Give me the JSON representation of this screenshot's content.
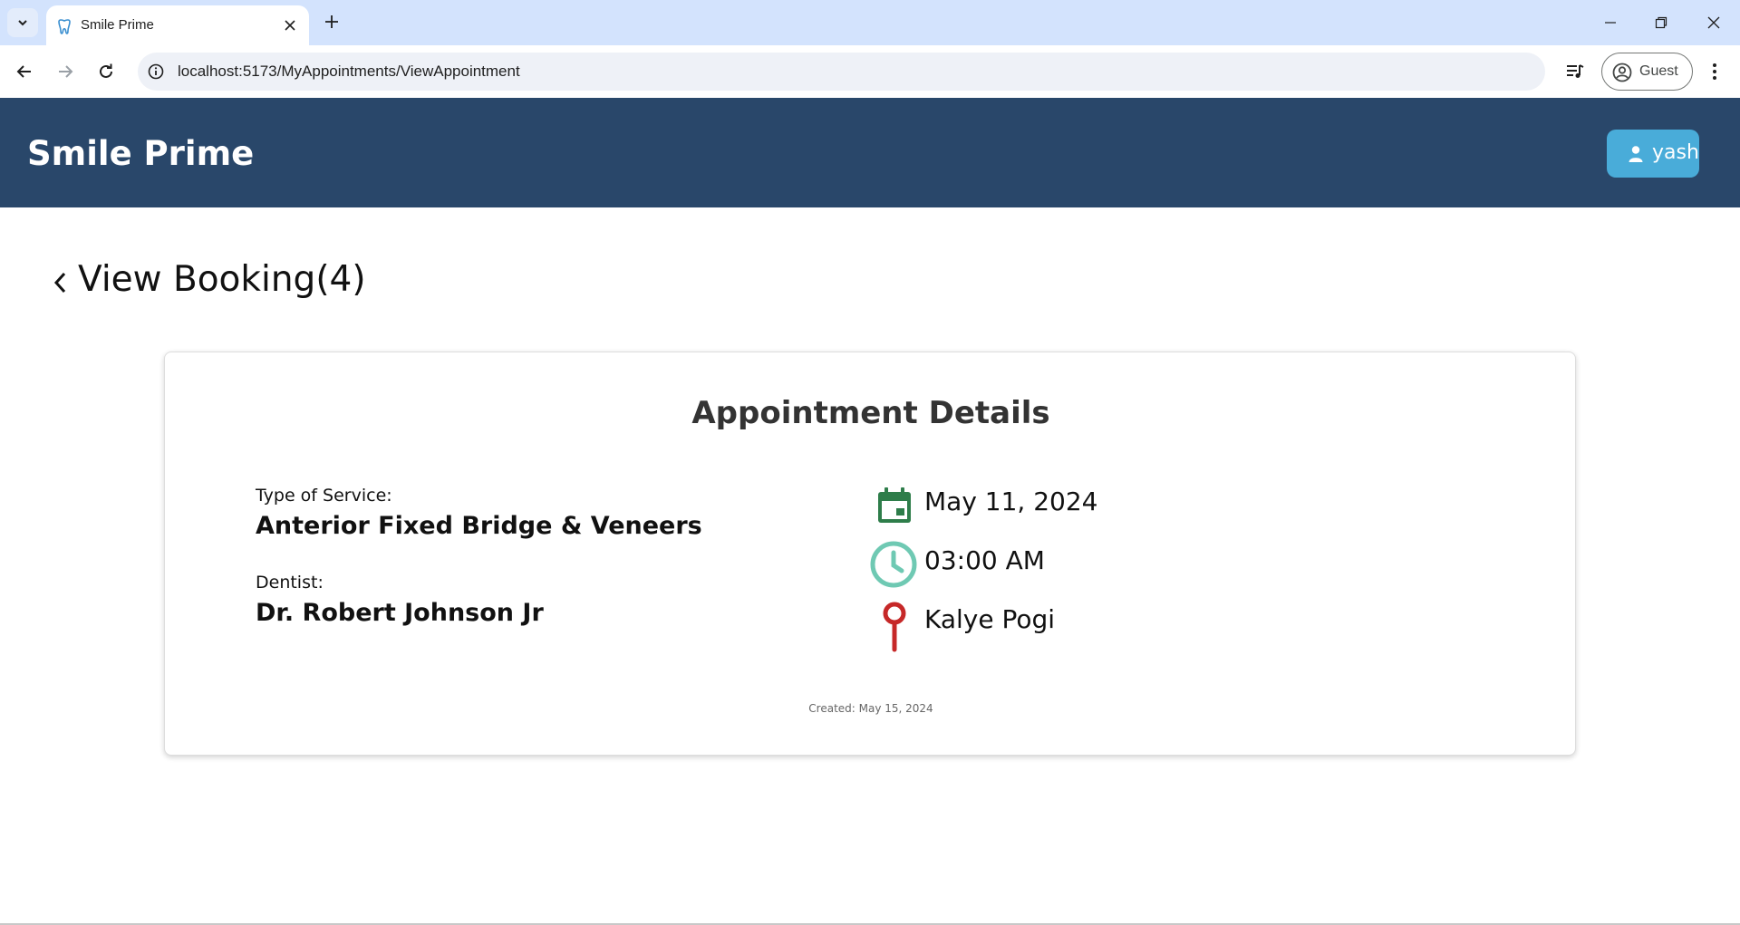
{
  "browser": {
    "tab_title": "Smile Prime",
    "url": "localhost:5173/MyAppointments/ViewAppointment",
    "profile_label": "Guest"
  },
  "header": {
    "brand": "Smile Prime",
    "user_name": "yash"
  },
  "page": {
    "title": "View Booking(4)"
  },
  "appointment": {
    "heading": "Appointment Details",
    "service_label": "Type of Service:",
    "service_value": "Anterior Fixed Bridge & Veneers",
    "dentist_label": "Dentist:",
    "dentist_value": "Dr. Robert Johnson Jr",
    "date": "May 11, 2024",
    "time": "03:00 AM",
    "location": "Kalye Pogi",
    "created": "Created: May 15, 2024"
  },
  "colors": {
    "header_bg": "#29476a",
    "user_button": "#49acd9",
    "calendar_icon": "#2e7d4a",
    "clock_icon": "#6fc9b3",
    "pin_icon": "#c62828"
  },
  "icons": [
    "tab-search-icon",
    "tooth-icon",
    "close-icon",
    "plus-icon",
    "minimize-icon",
    "restore-icon",
    "back-arrow-icon",
    "forward-arrow-icon",
    "reload-icon",
    "info-icon",
    "media-control-icon",
    "profile-icon",
    "kebab-menu-icon",
    "person-icon",
    "chevron-left-icon",
    "calendar-icon",
    "clock-icon",
    "map-pin-icon"
  ]
}
